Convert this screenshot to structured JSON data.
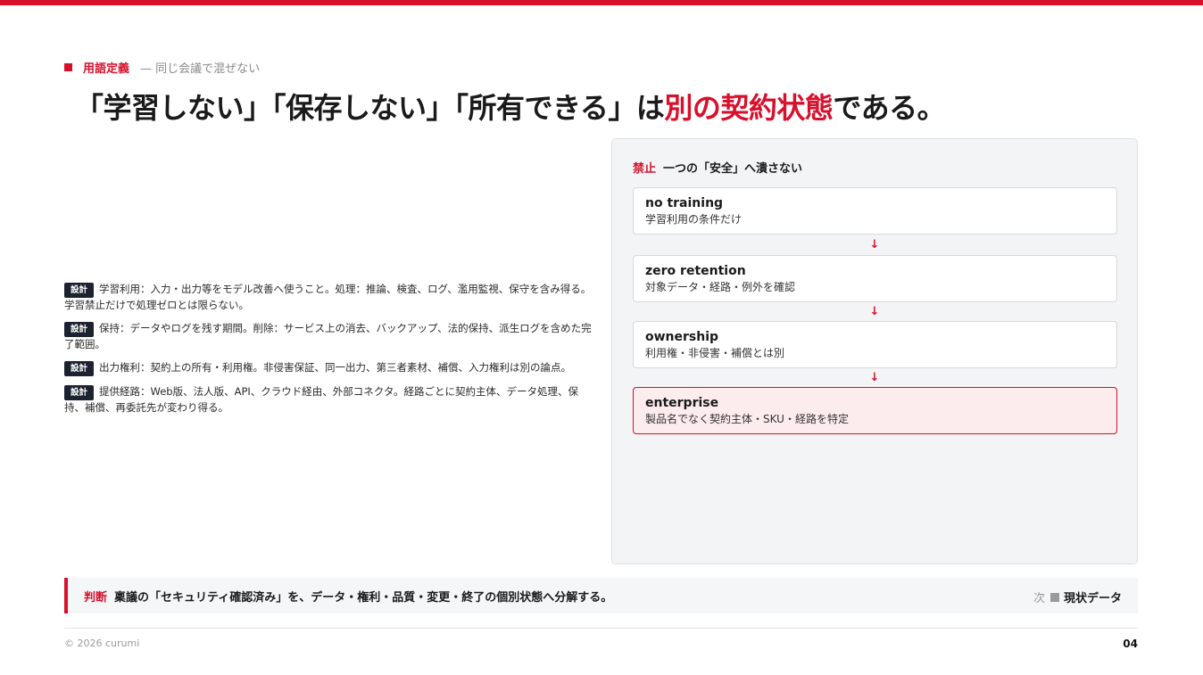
{
  "section": {
    "kicker": "用語定義",
    "sub": "— 同じ会議で混ぜない"
  },
  "headline": {
    "part1": "「学習しない」「保存しない」「所有できる」は",
    "accent": "別の契約状態",
    "part2": "である。"
  },
  "notes": [
    {
      "tag": "設計",
      "text": "学習利用：入力・出力等をモデル改善へ使うこと。処理：推論、検査、ログ、濫用監視、保守を含み得る。学習禁止だけで処理ゼロとは限らない。"
    },
    {
      "tag": "設計",
      "text": "保持：データやログを残す期間。削除：サービス上の消去、バックアップ、法的保持、派生ログを含めた完了範囲。"
    },
    {
      "tag": "設計",
      "text": "出力権利：契約上の所有・利用権。非侵害保証、同一出力、第三者素材、補償、入力権利は別の論点。"
    },
    {
      "tag": "設計",
      "text": "提供経路：Web版、法人版、API、クラウド経由、外部コネクタ。経路ごとに契約主体、データ処理、保持、補償、再委託先が変わり得る。"
    }
  ],
  "panel": {
    "label": "禁止",
    "title": "一つの「安全」へ潰さない",
    "arrow": "↓",
    "steps": [
      {
        "title": "no training",
        "desc": "学習利用の条件だけ"
      },
      {
        "title": "zero retention",
        "desc": "対象データ・経路・例外を確認"
      },
      {
        "title": "ownership",
        "desc": "利用権・非侵害・補償とは別"
      },
      {
        "title": "enterprise",
        "desc": "製品名でなく契約主体・SKU・経路を特定"
      }
    ]
  },
  "verdict": {
    "label": "判断",
    "text": "稟議の「セキュリティ確認済み」を、データ・権利・品質・変更・終了の個別状態へ分解する。",
    "next_prefix": "次",
    "next": "現状データ"
  },
  "footer": {
    "copyright": "© 2026 curumi",
    "page": "04"
  },
  "colors": {
    "accent": "#d8102c",
    "tag_bg": "#1c2230"
  }
}
